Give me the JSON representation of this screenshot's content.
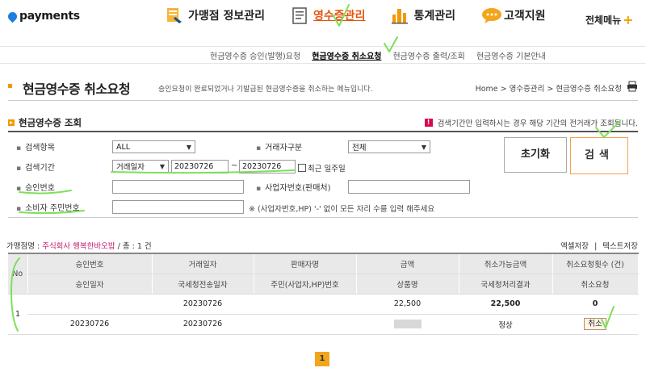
{
  "brand": {
    "name": "payments"
  },
  "gnb": [
    {
      "label": "가맹점 정보관리",
      "icon": "merchant-info-icon",
      "active": false
    },
    {
      "label": "영수증관리",
      "icon": "receipt-icon",
      "active": true
    },
    {
      "label": "통계관리",
      "icon": "bar-chart-icon",
      "active": false
    },
    {
      "label": "고객지원",
      "icon": "chat-bubble-icon",
      "active": false
    }
  ],
  "gnb_all": {
    "label": "전체메뉴",
    "icon": "plus-icon"
  },
  "subnav": [
    {
      "label": "현금영수증 승인(발행)요청",
      "active": false
    },
    {
      "label": "현금영수증 취소요청",
      "active": true
    },
    {
      "label": "현금영수증 출력/조회",
      "active": false
    },
    {
      "label": "현금영수증 기본안내",
      "active": false
    }
  ],
  "page": {
    "title": "현금영수증 취소요청",
    "description": "승인요청이 완료되었거나 기발급된 현금영수증을 취소하는 메뉴입니다.",
    "breadcrumb": "Home > 영수증관리 > 현금영수증 취소요청",
    "print_icon": "printer-icon"
  },
  "search": {
    "section_title": "현금영수증 조회",
    "note": "검색기간만 입력하시는 경우 해당 기간의 전거래가 조회됩니다.",
    "fields": {
      "item_label": "검색항목",
      "item_value": "ALL",
      "party_label": "거래자구분",
      "party_value": "전체",
      "period_label": "검색기간",
      "period_type": "거래일자",
      "date_from": "20230726",
      "date_sep": "~",
      "date_to": "20230726",
      "recent_week_label": "최근 일주일",
      "approval_label": "승인번호",
      "approval_value": "",
      "bizno_label": "사업자번호(판매처)",
      "bizno_value": "",
      "consumer_label": "소비자 주민번호",
      "consumer_value": "",
      "consumer_hint": "※ (사업자번호,HP) '-' 없이 모든 자리 수를 입력 해주세요"
    },
    "reset_label": "초기화",
    "search_label": "검색"
  },
  "result": {
    "merchant_label": "가맹점명 : ",
    "merchant_name": "주식회사 행복한바오밥",
    "total_label": " / 총 : 1 건",
    "excel_label": "엑셀저장",
    "sep": "|",
    "text_label": "텍스트저장"
  },
  "table": {
    "no_header": "No",
    "header_row1": [
      "승인번호",
      "거래일자",
      "판매자명",
      "금액",
      "취소가능금액",
      "취소요청횟수 (건)"
    ],
    "header_row2": [
      "승인일자",
      "국세청전송일자",
      "주민(사업자,HP)번호",
      "상품명",
      "국세청처리결과",
      "취소요청"
    ],
    "rows": [
      {
        "no": "1",
        "approval_no": "",
        "trade_date": "20230726",
        "seller": "",
        "amount": "22,500",
        "cancelable": "22,500",
        "cancel_count": "0",
        "approval_date": "20230726",
        "nts_date": "20230726",
        "id_no": "",
        "product": "",
        "nts_result": "정상",
        "cancel_button": "취소"
      }
    ]
  },
  "pager": {
    "current": "1"
  },
  "colors": {
    "accent": "#f39800",
    "active_text": "#e8530b",
    "highlight": "#d6001c",
    "annotation": "#7ee05a"
  }
}
